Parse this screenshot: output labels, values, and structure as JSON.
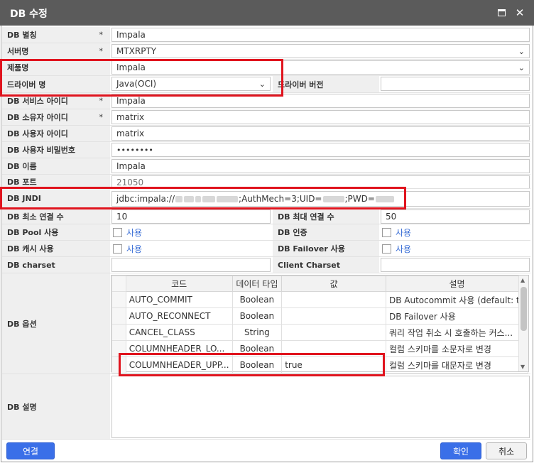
{
  "window": {
    "title": "DB 수정",
    "maximize_icon": "maximize-icon",
    "close_glyph": "✕"
  },
  "form": {
    "alias": {
      "label": "DB 별칭",
      "required": "*",
      "value": "Impala"
    },
    "server": {
      "label": "서버명",
      "required": "*",
      "value": "MTXRPTY"
    },
    "product": {
      "label": "제품명",
      "value": "Impala"
    },
    "driver": {
      "label": "드라이버 명",
      "value": "Java(OCI)"
    },
    "driver_version": {
      "label": "드라이버 버전",
      "value": ""
    },
    "service_id": {
      "label": "DB 서비스 아이디",
      "required": "*",
      "value": "Impala"
    },
    "owner_id": {
      "label": "DB 소유자 아이디",
      "required": "*",
      "value": "matrix"
    },
    "user_id": {
      "label": "DB 사용자 아이디",
      "value": "matrix"
    },
    "password": {
      "label": "DB 사용자 비밀번호",
      "value": "••••••••"
    },
    "db_name": {
      "label": "DB 이름",
      "value": "Impala"
    },
    "port": {
      "label": "DB 포트",
      "value": "21050"
    },
    "jndi": {
      "label": "DB JNDI",
      "prefix": "jdbc:impala://",
      "part_authmech": ";AuthMech=3;UID=",
      "part_pwd": ";PWD="
    },
    "min_conn": {
      "label": "DB 최소 연결 수",
      "value": "10"
    },
    "max_conn": {
      "label": "DB 최대 연결 수",
      "value": "50"
    },
    "pool": {
      "label": "DB Pool 사용",
      "option": "사용"
    },
    "auth": {
      "label": "DB 인증",
      "option": "사용"
    },
    "cache": {
      "label": "DB 캐시 사용",
      "option": "사용"
    },
    "failover": {
      "label": "DB Failover 사용",
      "option": "사용"
    },
    "charset": {
      "label": "DB charset",
      "value": ""
    },
    "client_charset": {
      "label": "Client Charset",
      "value": ""
    },
    "options": {
      "label": "DB 옵션",
      "columns": [
        "코드",
        "데이터 타입",
        "값",
        "설명"
      ],
      "rows": [
        {
          "code": "AUTO_COMMIT",
          "type": "Boolean",
          "value": "",
          "desc": "DB Autocommit 사용 (default: tru..."
        },
        {
          "code": "AUTO_RECONNECT",
          "type": "Boolean",
          "value": "",
          "desc": "DB Failover 사용"
        },
        {
          "code": "CANCEL_CLASS",
          "type": "String",
          "value": "",
          "desc": "쿼리 작업 취소 시 호출하는 커스..."
        },
        {
          "code": "COLUMNHEADER_LO...",
          "type": "Boolean",
          "value": "",
          "desc": "컬럼 스키마를 소문자로 변경"
        },
        {
          "code": "COLUMNHEADER_UPP...",
          "type": "Boolean",
          "value": "true",
          "desc": "컬럼 스키마를 대문자로 변경"
        }
      ]
    },
    "description": {
      "label": "DB 설명",
      "value": ""
    }
  },
  "footer": {
    "connect_label": "연결",
    "ok_label": "확인",
    "cancel_label": "취소"
  },
  "colors": {
    "title_bar": "#5b5b5b",
    "primary_button": "#3a6fe8",
    "highlight": "#e0141e",
    "link": "#3b6fd6"
  }
}
